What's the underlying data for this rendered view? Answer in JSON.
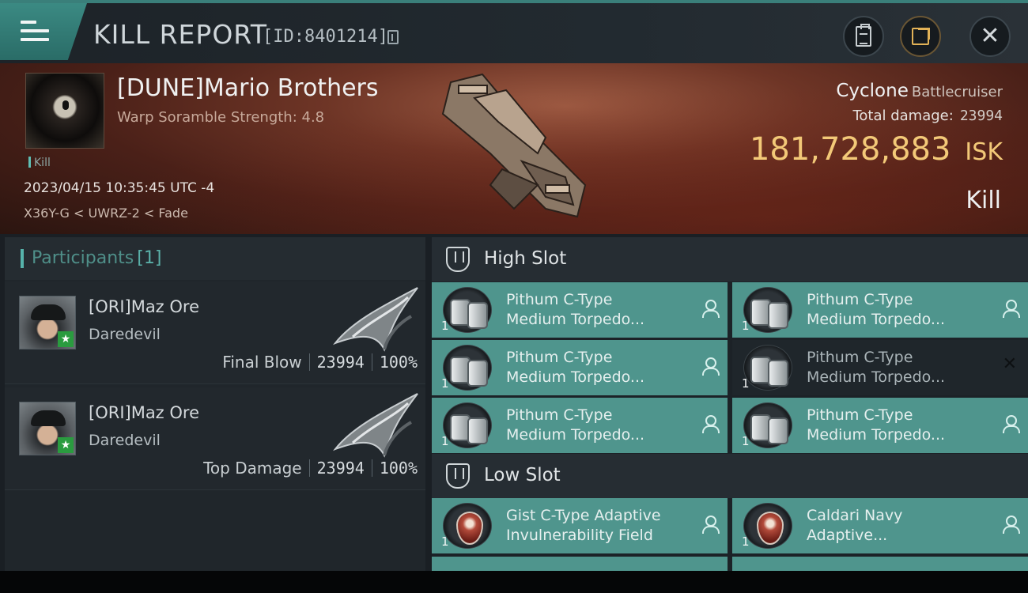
{
  "header": {
    "title": "KILL REPORT",
    "report_id": "[ID:8401214]"
  },
  "victim": {
    "name": "[DUNE]Mario Brothers",
    "warp_scramble": "Warp Soramble Strength: 4.8",
    "tag": "Kill",
    "timestamp": "2023/04/15 10:35:45 UTC -4",
    "location": "X36Y-G < UWRZ-2 < Fade",
    "ship": "Cyclone",
    "ship_class": "Battlecruiser",
    "total_damage_label": "Total damage:",
    "total_damage": "23994",
    "isk_value": "181,728,883",
    "isk_unit": "ISK",
    "result": "Kill"
  },
  "participants": {
    "title": "Participants",
    "count": "[1]",
    "rows": [
      {
        "name": "[ORI]Maz Ore",
        "ship": "Daredevil",
        "role": "Final Blow",
        "damage": "23994",
        "percent": "100%"
      },
      {
        "name": "[ORI]Maz Ore",
        "ship": "Daredevil",
        "role": "Top Damage",
        "damage": "23994",
        "percent": "100%"
      }
    ]
  },
  "slots": {
    "high": {
      "title": "High Slot",
      "modules": [
        {
          "line1": "Pithum C-Type",
          "line2": "Medium Torpedo...",
          "qty": "1",
          "state": "dropped"
        },
        {
          "line1": "Pithum C-Type",
          "line2": "Medium Torpedo...",
          "qty": "1",
          "state": "dropped"
        },
        {
          "line1": "Pithum C-Type",
          "line2": "Medium Torpedo...",
          "qty": "1",
          "state": "dropped"
        },
        {
          "line1": "Pithum C-Type",
          "line2": "Medium Torpedo...",
          "qty": "1",
          "state": "destroyed"
        },
        {
          "line1": "Pithum C-Type",
          "line2": "Medium Torpedo...",
          "qty": "1",
          "state": "dropped"
        },
        {
          "line1": "Pithum C-Type",
          "line2": "Medium Torpedo...",
          "qty": "1",
          "state": "dropped"
        }
      ]
    },
    "low": {
      "title": "Low Slot",
      "modules": [
        {
          "line1": "Gist C-Type Adaptive",
          "line2": "Invulnerability Field",
          "qty": "1",
          "state": "dropped"
        },
        {
          "line1": "Caldari Navy",
          "line2": "Adaptive...",
          "qty": "1",
          "state": "dropped"
        }
      ]
    }
  },
  "colors": {
    "accent": "#4f958d",
    "isk": "#f3c978",
    "header_bar": "#3a7f7a"
  }
}
